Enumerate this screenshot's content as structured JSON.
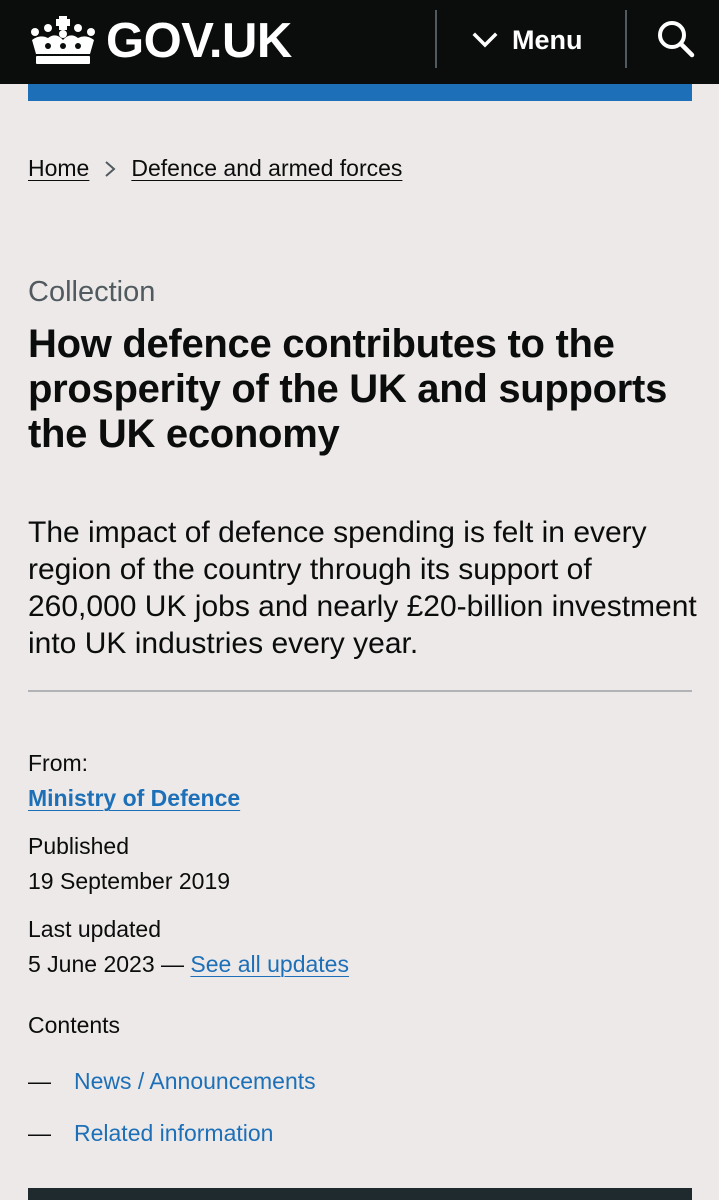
{
  "header": {
    "logo_text": "GOV.UK",
    "menu_label": "Menu",
    "icons": {
      "crown": "crown-icon",
      "menu": "chevron-down-icon",
      "search": "search-icon"
    },
    "background": "#0b0c0c",
    "accent_bar": "#1d70b8"
  },
  "breadcrumb": {
    "items": [
      "Home",
      "Defence and armed forces"
    ]
  },
  "page": {
    "caption": "Collection",
    "title": "How defence contributes to the prosperity of the UK and supports the UK economy",
    "lead": "The impact of defence spending is felt in every region of the country through its support of 260,000 UK jobs and nearly £20-billion investment into UK industries every year."
  },
  "metadata": {
    "from_label": "From:",
    "organisation": "Ministry of Defence",
    "published_label": "Published",
    "published_date": "19 September 2019",
    "updated_label": "Last updated",
    "updated_date": "5 June 2023 —",
    "see_updates": "See all updates"
  },
  "contents": {
    "title": "Contents",
    "dash": "—",
    "items": [
      "News / Announcements",
      "Related information"
    ]
  },
  "colors": {
    "link": "#1d70b8",
    "text": "#0b0c0c",
    "secondary_text": "#505a5f",
    "page_background": "#ede9e8"
  }
}
